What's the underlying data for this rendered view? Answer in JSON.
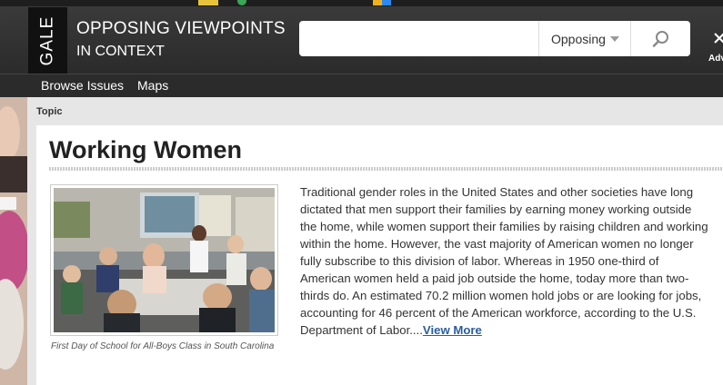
{
  "header": {
    "logo_text": "GALE",
    "title_line1": "OPPOSING VIEWPOINTS",
    "title_line2": "IN CONTEXT",
    "advanced_label": "Adv"
  },
  "search": {
    "value": "",
    "placeholder": "",
    "scope_selected": "Opposing"
  },
  "nav": {
    "items": [
      {
        "label": "Browse Issues"
      },
      {
        "label": "Maps"
      }
    ]
  },
  "breadcrumb": {
    "label": "Topic"
  },
  "topic": {
    "title": "Working Women",
    "image_caption": "First Day of School for All-Boys Class in South Carolina",
    "summary": "Traditional gender roles in the United States and other societies have long dictated that men support their families by earning money working outside the home, while women support their families by raising children and working within the home. However, the vast majority of American women no longer fully subscribe to this division of labor. Whereas in 1950 one-third of American women held a paid job outside the home, today more than two-thirds do. An estimated 70.2 million women hold jobs or are looking for jobs, accounting for 46 percent of the American workforce, according to the U.S. Department of Labor....",
    "view_more_label": "View More"
  },
  "icons": {
    "search": "search-icon",
    "scope_dropdown": "chevron-down-icon",
    "advanced": "advanced-search-icon"
  },
  "colors": {
    "header_bg": "#2b2b2b",
    "logo_bg": "#111111",
    "link": "#2a5d9f",
    "band_bg": "#e6e6e6"
  }
}
